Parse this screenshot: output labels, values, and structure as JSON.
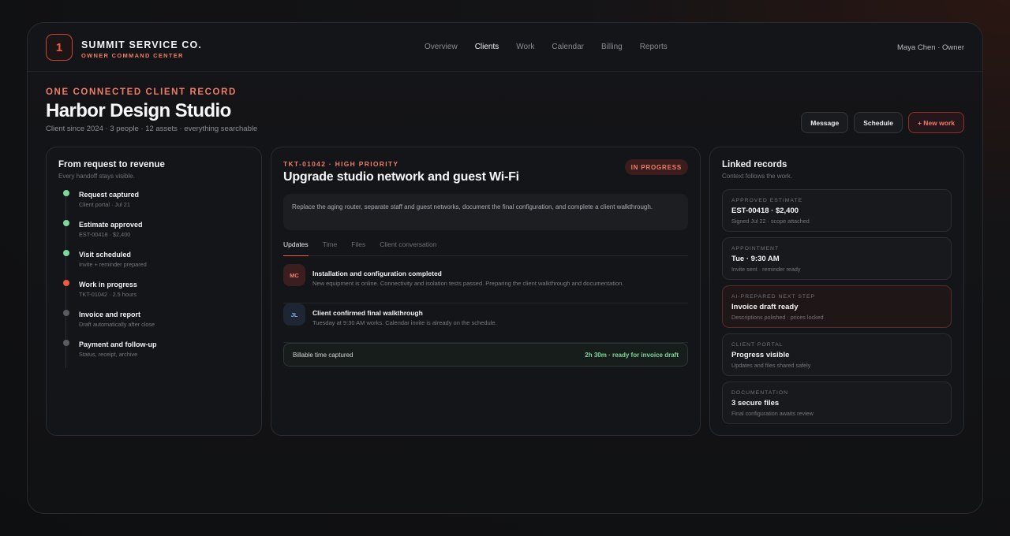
{
  "brand": {
    "logo_text": "1",
    "name": "SUMMIT SERVICE CO.",
    "subtitle": "OWNER COMMAND CENTER"
  },
  "nav": [
    "Overview",
    "Clients",
    "Work",
    "Calendar",
    "Billing",
    "Reports"
  ],
  "nav_active": "Clients",
  "user": "Maya Chen · Owner",
  "header": {
    "eyebrow": "ONE CONNECTED CLIENT RECORD",
    "title": "Harbor Design Studio",
    "subtitle": "Client since 2024 · 3 people · 12 assets · everything searchable"
  },
  "actions": {
    "message": "Message",
    "schedule": "Schedule",
    "new_work": "+ New work"
  },
  "timeline_card": {
    "title": "From request to revenue",
    "subtitle": "Every handoff stays visible.",
    "steps": [
      {
        "label": "Request captured",
        "meta": "Client portal · Jul 21",
        "state": "done"
      },
      {
        "label": "Estimate approved",
        "meta": "EST-00418 · $2,400",
        "state": "done"
      },
      {
        "label": "Visit scheduled",
        "meta": "Invite + reminder prepared",
        "state": "done"
      },
      {
        "label": "Work in progress",
        "meta": "TKT-01042 · 2.5 hours",
        "state": "active"
      },
      {
        "label": "Invoice and report",
        "meta": "Draft automatically after close",
        "state": "todo"
      },
      {
        "label": "Payment and follow-up",
        "meta": "Status, receipt, archive",
        "state": "todo"
      }
    ]
  },
  "ticket": {
    "eyebrow": "TKT-01042 · HIGH PRIORITY",
    "title": "Upgrade studio network and guest Wi-Fi",
    "status": "IN PROGRESS",
    "description": "Replace the aging router, separate staff and guest networks, document the final configuration, and complete a client walkthrough.",
    "tabs": [
      "Updates",
      "Time",
      "Files",
      "Client conversation"
    ],
    "active_tab": "Updates",
    "updates": [
      {
        "initials": "MC",
        "title": "Installation and configuration completed",
        "text": "New equipment is online. Connectivity and isolation tests passed. Preparing the client walkthrough and documentation."
      },
      {
        "initials": "JL",
        "title": "Client confirmed final walkthrough",
        "text": "Tuesday at 9:30 AM works. Calendar invite is already on the schedule."
      }
    ],
    "billable_label": "Billable time captured",
    "billable_value": "2h 30m · ready for invoice draft"
  },
  "linked": {
    "title": "Linked records",
    "subtitle": "Context follows the work.",
    "records": [
      {
        "eyebrow": "APPROVED ESTIMATE",
        "title": "EST-00418 · $2,400",
        "meta": "Signed Jul 22 · scope attached"
      },
      {
        "eyebrow": "APPOINTMENT",
        "title": "Tue · 9:30 AM",
        "meta": "Invite sent · reminder ready"
      },
      {
        "eyebrow": "AI-PREPARED NEXT STEP",
        "title": "Invoice draft ready",
        "meta": "Descriptions polished · prices locked"
      },
      {
        "eyebrow": "CLIENT PORTAL",
        "title": "Progress visible",
        "meta": "Updates and files shared safely"
      },
      {
        "eyebrow": "DOCUMENTATION",
        "title": "3 secure files",
        "meta": "Final configuration awaits review"
      }
    ]
  },
  "colors": {
    "accent": "#ef5a43",
    "success": "#7ed89a",
    "background": "#111214"
  }
}
